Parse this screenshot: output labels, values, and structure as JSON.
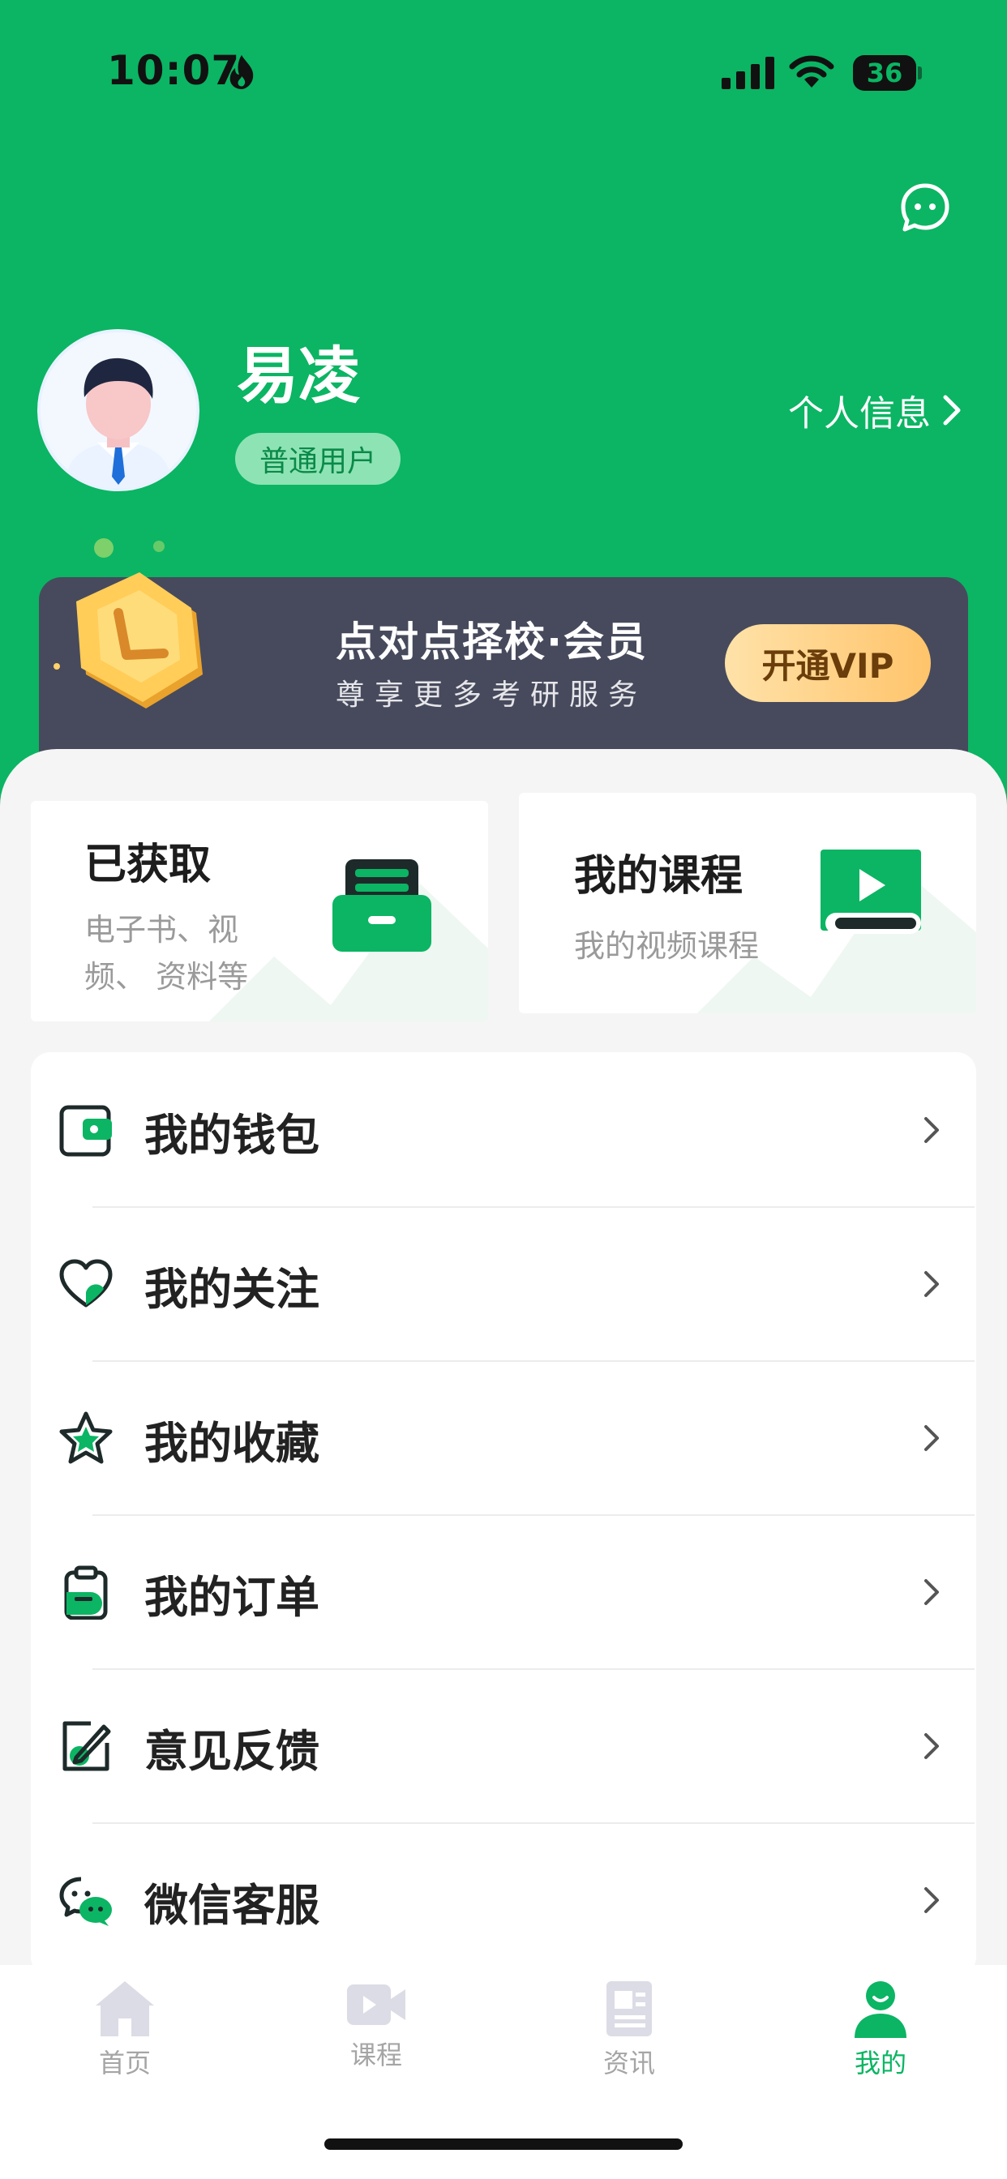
{
  "status_bar": {
    "time": "10:07",
    "battery": "36"
  },
  "colors": {
    "brand_green": "#0bb563",
    "vip_dark": "#474a5c",
    "vip_gold": "#ffc46b"
  },
  "header": {
    "message_icon": "chat-bubble-icon",
    "user_name": "易凌",
    "user_badge": "普通用户",
    "profile_link": "个人信息"
  },
  "vip": {
    "title": "点对点择校·会员",
    "subtitle": "尊享更多考研服务",
    "button": "开通VIP"
  },
  "cards": [
    {
      "title": "已获取",
      "subtitle_line1": "电子书、视",
      "subtitle_line2": "频、 资料等",
      "icon": "archive-box-icon"
    },
    {
      "title": "我的课程",
      "subtitle": "我的视频课程",
      "icon": "video-course-icon"
    }
  ],
  "menu": [
    {
      "label": "我的钱包",
      "icon": "wallet-icon"
    },
    {
      "label": "我的关注",
      "icon": "heart-icon"
    },
    {
      "label": "我的收藏",
      "icon": "star-icon"
    },
    {
      "label": "我的订单",
      "icon": "clipboard-icon"
    },
    {
      "label": "意见反馈",
      "icon": "edit-icon"
    },
    {
      "label": "微信客服",
      "icon": "wechat-icon"
    }
  ],
  "tabbar": [
    {
      "label": "首页",
      "icon": "home-icon",
      "active": false
    },
    {
      "label": "课程",
      "icon": "video-icon",
      "active": false
    },
    {
      "label": "资讯",
      "icon": "news-icon",
      "active": false
    },
    {
      "label": "我的",
      "icon": "profile-icon",
      "active": true
    }
  ]
}
